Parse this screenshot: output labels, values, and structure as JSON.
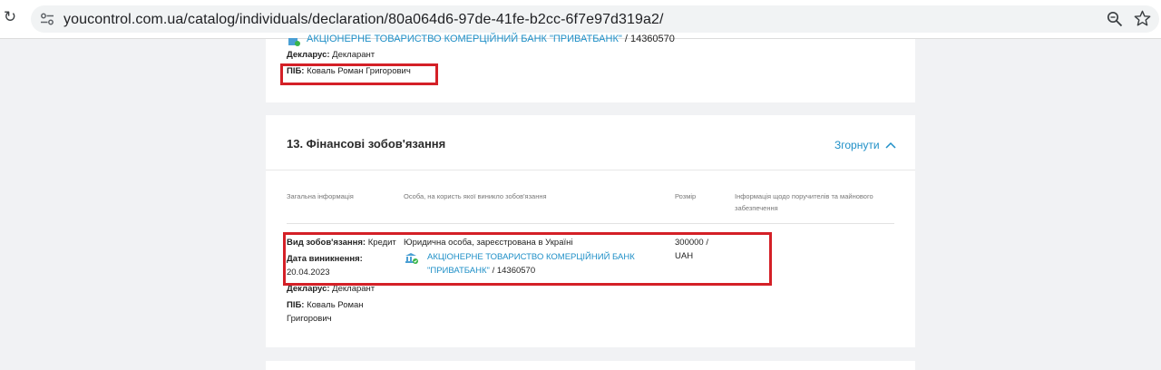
{
  "browser": {
    "url": "youcontrol.com.ua/catalog/individuals/declaration/80a064d6-97de-41fe-b2cc-6f7e97d319a2/"
  },
  "top_card": {
    "bank_partial": "АКЦІОНЕРНЕ ТОВАРИСТВО КОМЕРЦІЙНИЙ БАНК \"ПРИВАТБАНК\"",
    "code_partial": "/ 14360570",
    "declarant_label": "Декларус:",
    "declarant_value": "Декларант",
    "pib_label": "ПІБ:",
    "pib_value": "Коваль Роман Григорович"
  },
  "section": {
    "title": "13. Фінансові зобов'язання",
    "collapse_label": "Згорнути",
    "columns": [
      "Загальна інформація",
      "Особа, на користь якої виникло зобов'язання",
      "Розмір",
      "Інформація щодо поручителів та майнового забезпечення"
    ],
    "row": {
      "type_label": "Вид зобов'язання:",
      "type_value": "Кредит",
      "date_label": "Дата виникнення:",
      "date_value": "20.04.2023",
      "declarant_label": "Декларус:",
      "declarant_value": "Декларант",
      "pib_label": "ПІБ:",
      "pib_value_line1": "Коваль Роман",
      "pib_value_line2": "Григорович",
      "entity_desc": "Юридична особа, зареєстрована в Україні",
      "bank_line1": "АКЦІОНЕРНЕ ТОВАРИСТВО КОМЕРЦІЙНИЙ БАНК",
      "bank_line2": "\"ПРИВАТБАНК\"",
      "bank_code": "/ 14360570",
      "amount_line1": "300000 /",
      "amount_line2": "UAH"
    }
  },
  "colors": {
    "accent": "#1e8fc7",
    "highlight": "#d42027",
    "page_bg": "#f1f2f4"
  }
}
